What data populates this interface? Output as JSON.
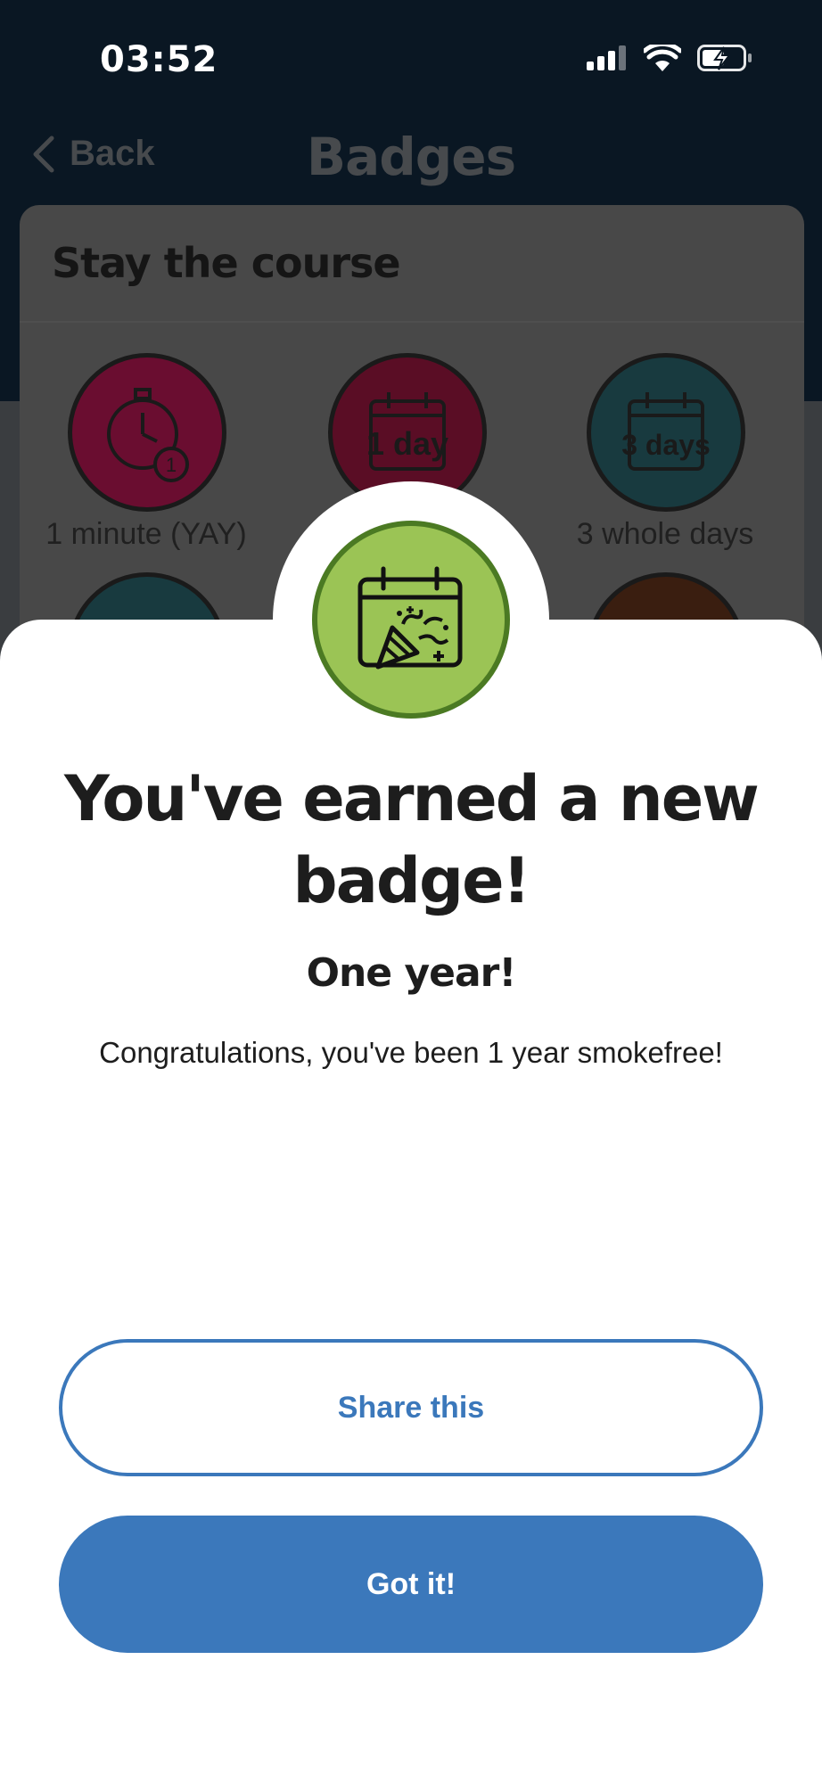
{
  "status_bar": {
    "time": "03:52",
    "icons": [
      "cellular-signal-icon",
      "wifi-icon",
      "battery-charging-icon"
    ]
  },
  "header": {
    "back_label": "Back",
    "title": "Badges"
  },
  "badge_card": {
    "section_title": "Stay the course",
    "badges": [
      {
        "caption": "1 minute (YAY)",
        "icon": "stopwatch-icon",
        "color": "#6a0d30"
      },
      {
        "caption": "",
        "icon_text": "1 day",
        "icon": "calendar-1day-icon",
        "color": "#5a0d25"
      },
      {
        "caption": "3 whole days",
        "icon_text": "3 days",
        "icon": "calendar-3days-icon",
        "color": "#183a3f"
      }
    ]
  },
  "modal": {
    "headline": "You've earned a new badge!",
    "badge_name": "One year!",
    "message": "Congratulations, you've been 1 year smokefree!",
    "medal_icon": "calendar-party-popper-icon",
    "medal_color": "#9bc455",
    "share_label": "Share this",
    "ok_label": "Got it!"
  },
  "colors": {
    "accent": "#3b78bb",
    "header_bg": "#0a1723"
  }
}
